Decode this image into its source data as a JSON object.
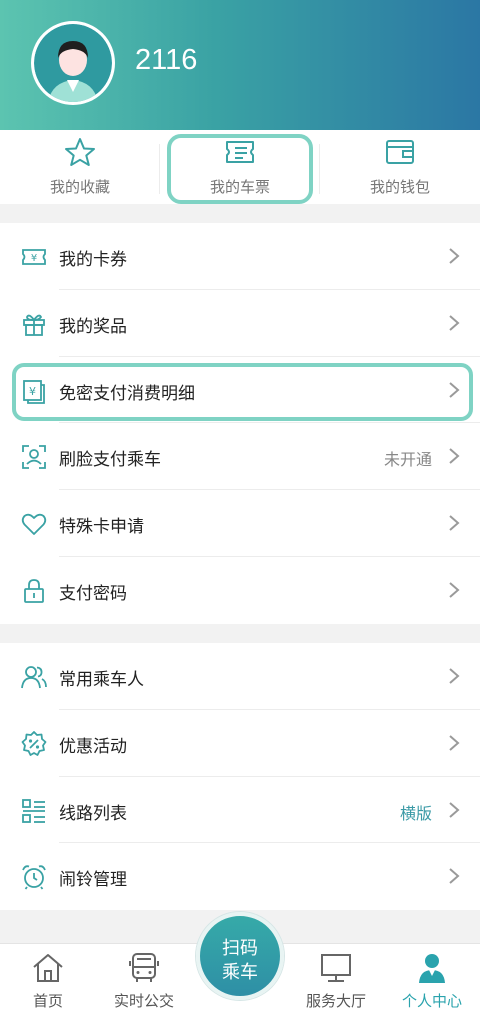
{
  "header": {
    "username": "2116"
  },
  "quick_actions": [
    {
      "label": "我的收藏",
      "icon": "star-icon"
    },
    {
      "label": "我的车票",
      "icon": "ticket-icon"
    },
    {
      "label": "我的钱包",
      "icon": "wallet-icon"
    }
  ],
  "menu_group_1": [
    {
      "label": "我的卡券",
      "icon": "coupon-icon",
      "value": ""
    },
    {
      "label": "我的奖品",
      "icon": "gift-icon",
      "value": ""
    },
    {
      "label": "免密支付消费明细",
      "icon": "payment-record-icon",
      "value": ""
    },
    {
      "label": "刷脸支付乘车",
      "icon": "face-scan-icon",
      "value": "未开通"
    },
    {
      "label": "特殊卡申请",
      "icon": "heart-icon",
      "value": ""
    },
    {
      "label": "支付密码",
      "icon": "lock-icon",
      "value": ""
    }
  ],
  "menu_group_2": [
    {
      "label": "常用乘车人",
      "icon": "users-icon",
      "value": ""
    },
    {
      "label": "优惠活动",
      "icon": "discount-icon",
      "value": ""
    },
    {
      "label": "线路列表",
      "icon": "list-icon",
      "value": "横版"
    },
    {
      "label": "闹铃管理",
      "icon": "alarm-clock-icon",
      "value": ""
    }
  ],
  "tabbar": {
    "home": "首页",
    "realtime_bus": "实时公交",
    "scan_line1": "扫码",
    "scan_line2": "乘车",
    "service_hall": "服务大厅",
    "personal_center": "个人中心",
    "active_tab": "个人中心"
  },
  "colors": {
    "accent": "#2aa3ad",
    "highlight": "#7fd3c4",
    "header_start": "#5cc4b0",
    "header_end": "#2b77a4"
  }
}
